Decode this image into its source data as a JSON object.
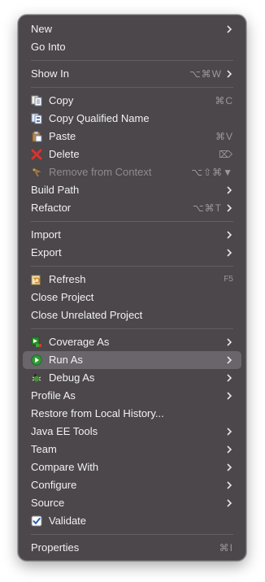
{
  "menu": {
    "new": {
      "label": "New"
    },
    "go_into": {
      "label": "Go Into"
    },
    "show_in": {
      "label": "Show In",
      "shortcut": "⌥⌘W"
    },
    "copy": {
      "label": "Copy",
      "shortcut": "⌘C"
    },
    "copy_qualified": {
      "label": "Copy Qualified Name"
    },
    "paste": {
      "label": "Paste",
      "shortcut": "⌘V"
    },
    "delete": {
      "label": "Delete",
      "shortcut": "⌦"
    },
    "remove_context": {
      "label": "Remove from Context",
      "shortcut": "⌥⇧⌘▼"
    },
    "build_path": {
      "label": "Build Path"
    },
    "refactor": {
      "label": "Refactor",
      "shortcut": "⌥⌘T"
    },
    "import": {
      "label": "Import"
    },
    "export": {
      "label": "Export"
    },
    "refresh": {
      "label": "Refresh",
      "shortcut": "F5"
    },
    "close_project": {
      "label": "Close Project"
    },
    "close_unrelated": {
      "label": "Close Unrelated Project"
    },
    "coverage_as": {
      "label": "Coverage As"
    },
    "run_as": {
      "label": "Run As"
    },
    "debug_as": {
      "label": "Debug As"
    },
    "profile_as": {
      "label": "Profile As"
    },
    "restore_history": {
      "label": "Restore from Local History..."
    },
    "java_ee_tools": {
      "label": "Java EE Tools"
    },
    "team": {
      "label": "Team"
    },
    "compare_with": {
      "label": "Compare With"
    },
    "configure": {
      "label": "Configure"
    },
    "source": {
      "label": "Source"
    },
    "validate": {
      "label": "Validate"
    },
    "properties": {
      "label": "Properties",
      "shortcut": "⌘I"
    }
  },
  "colors": {
    "menu_bg": "#4b474a",
    "highlight": "#69656a",
    "text": "#f2f1f2",
    "shortcut": "#9c989b",
    "disabled": "#8f8b8e"
  }
}
